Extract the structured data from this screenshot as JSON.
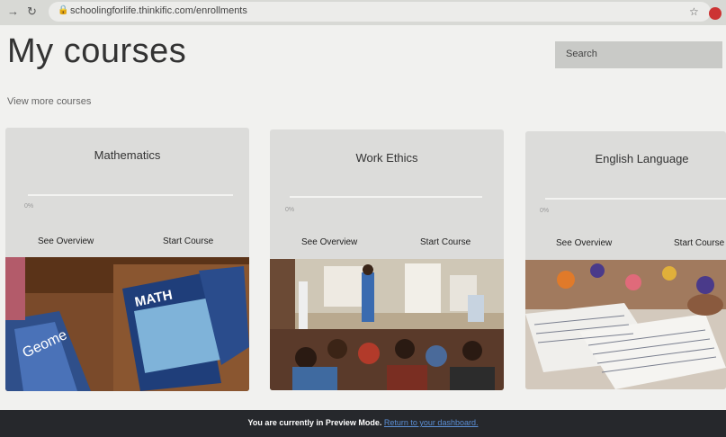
{
  "browser": {
    "url": "schoolingforlife.thinkific.com/enrollments"
  },
  "page": {
    "title": "My courses",
    "search_placeholder": "Search",
    "view_more": "View more courses"
  },
  "courses": [
    {
      "title": "Mathematics",
      "progress": "0%",
      "progress_value": 0,
      "overview": "See Overview",
      "start": "Start Course",
      "photo": "math-books"
    },
    {
      "title": "Work Ethics",
      "progress": "0%",
      "progress_value": 0,
      "overview": "See Overview",
      "start": "Start Course",
      "photo": "classroom"
    },
    {
      "title": "English Language",
      "progress": "0%",
      "progress_value": 0,
      "overview": "See Overview",
      "start": "Start Course",
      "photo": "papers"
    }
  ],
  "footer": {
    "message": "You are currently in Preview Mode.",
    "link": "Return to your dashboard."
  }
}
